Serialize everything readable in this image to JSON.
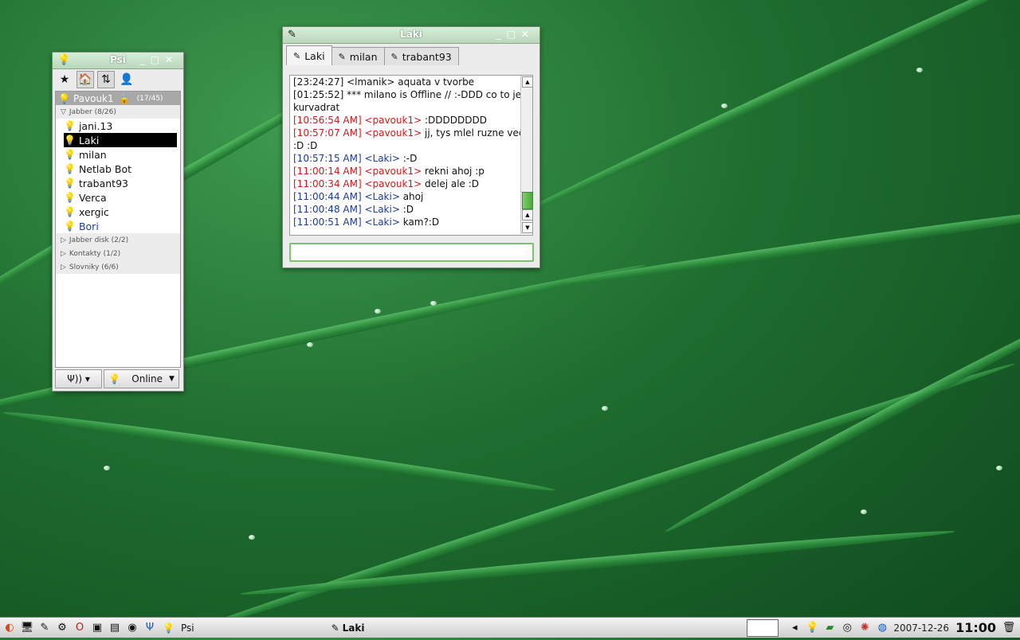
{
  "colors": {
    "accent_green": "#7bc46b",
    "own_nick": "#cc1a1a",
    "peer_nick": "#1a3c9c"
  },
  "roster_window": {
    "title": "Psi",
    "account": {
      "name": "Pavouk1",
      "count": "(17/45)"
    },
    "groups": [
      {
        "name": "Jabber",
        "count": "(8/26)",
        "expanded": true,
        "contacts": [
          {
            "name": "jani.13",
            "status": "online",
            "selected": false
          },
          {
            "name": "Laki",
            "status": "online",
            "selected": true
          },
          {
            "name": "milan",
            "status": "online",
            "selected": false
          },
          {
            "name": "Netlab Bot",
            "status": "online",
            "selected": false
          },
          {
            "name": "trabant93",
            "status": "online",
            "selected": false
          },
          {
            "name": "Verca",
            "status": "online",
            "selected": false
          },
          {
            "name": "xergic",
            "status": "online",
            "selected": false
          },
          {
            "name": "Bori",
            "status": "away",
            "selected": false
          }
        ]
      },
      {
        "name": "Jabber disk",
        "count": "(2/2)",
        "expanded": false
      },
      {
        "name": "Kontakty",
        "count": "(1/2)",
        "expanded": false
      },
      {
        "name": "Slovniky",
        "count": "(6/6)",
        "expanded": false
      }
    ],
    "status_button": "Online"
  },
  "chat_window": {
    "title": "Laki",
    "tabs": [
      "Laki",
      "milan",
      "trabant93"
    ],
    "active_tab": 0,
    "messages": [
      {
        "text": "[23:24:27] <lmanik> aquata v tvorbe",
        "color": "normal"
      },
      {
        "text": "[01:25:52] *** milano is Offline // :-DDD co to je kurvadrat",
        "color": "normal"
      },
      {
        "text": "[10:56:54 AM] <pavouk1> ",
        "tail": ":DDDDDDDD",
        "color": "red"
      },
      {
        "text": "[10:57:07 AM] <pavouk1> ",
        "tail": "jj, tys mlel ruzne veci :D :D",
        "color": "red"
      },
      {
        "text": "[10:57:15 AM] <Laki> ",
        "tail": ":-D",
        "color": "blue"
      },
      {
        "text": "[11:00:14 AM] <pavouk1> ",
        "tail": "rekni ahoj :p",
        "color": "red"
      },
      {
        "text": "[11:00:34 AM] <pavouk1> ",
        "tail": "delej ale :D",
        "color": "red"
      },
      {
        "text": "[11:00:44 AM] <Laki> ",
        "tail": "ahoj",
        "color": "blue"
      },
      {
        "text": "[11:00:48 AM] <Laki> ",
        "tail": ":D",
        "color": "blue"
      },
      {
        "text": "[11:00:51 AM] <Laki> ",
        "tail": "kam?:D",
        "color": "blue"
      }
    ],
    "input_value": ""
  },
  "taskbar": {
    "tasks": [
      {
        "label": "Psi"
      }
    ],
    "active_window": "Laki",
    "date": "2007-12-26",
    "time": "11:00"
  }
}
